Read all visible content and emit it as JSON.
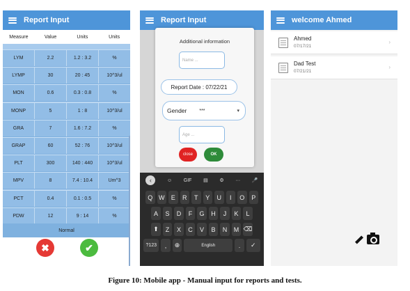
{
  "screen1": {
    "title": "Report Input",
    "headers": [
      "Measure",
      "Value",
      "Units",
      "Units"
    ],
    "rows": [
      [
        "LYM",
        "2.2",
        "1.2 : 3.2",
        "%"
      ],
      [
        "LYMP",
        "30",
        "20 : 45",
        "10^3/ul"
      ],
      [
        "MON",
        "0.6",
        "0.3 : 0.8",
        "%"
      ],
      [
        "MONP",
        "5",
        "1 : 8",
        "10^3/ul"
      ],
      [
        "GRA",
        "7",
        "1.6 : 7.2",
        "%"
      ],
      [
        "GRAP",
        "60",
        "52 : 76",
        "10^3/ul"
      ],
      [
        "PLT",
        "300",
        "140 : 440",
        "10^3/ul"
      ],
      [
        "MPV",
        "8",
        "7.4 : 10.4",
        "Um^3"
      ],
      [
        "PCT",
        "0.4",
        "0.1 : 0.5",
        "%"
      ],
      [
        "PDW",
        "12",
        "9 : 14",
        "%"
      ]
    ],
    "status": "Normal",
    "cancel_symbol": "✖",
    "confirm_symbol": "✔"
  },
  "screen2": {
    "title": "Report Input",
    "dialog_title": "Additional information",
    "name_placeholder": "Name ...",
    "report_date": "Report Date : 07/22/21",
    "gender_label": "Gender",
    "gender_value": "***",
    "age_placeholder": "Age ...",
    "close_label": "close",
    "ok_label": "OK",
    "keyboard": {
      "toolbar": [
        "‹",
        "☺",
        "GIF",
        "▤",
        "⚙",
        "···",
        "🎤"
      ],
      "row1": [
        "Q",
        "W",
        "E",
        "R",
        "T",
        "Y",
        "U",
        "I",
        "O",
        "P"
      ],
      "row2": [
        "A",
        "S",
        "D",
        "F",
        "G",
        "H",
        "J",
        "K",
        "L"
      ],
      "row3": [
        "⬆",
        "Z",
        "X",
        "C",
        "V",
        "B",
        "N",
        "M",
        "⌫"
      ],
      "row4_left": "?123",
      "space_label": "English",
      "period": ".",
      "enter": "✓"
    }
  },
  "screen3": {
    "title": "welcome Ahmed",
    "items": [
      {
        "name": "Ahmed",
        "date": "07/17/21"
      },
      {
        "name": "Dad Test",
        "date": "07/21/21"
      }
    ]
  },
  "caption": "Figure 10:  Mobile app - Manual input for reports and tests."
}
